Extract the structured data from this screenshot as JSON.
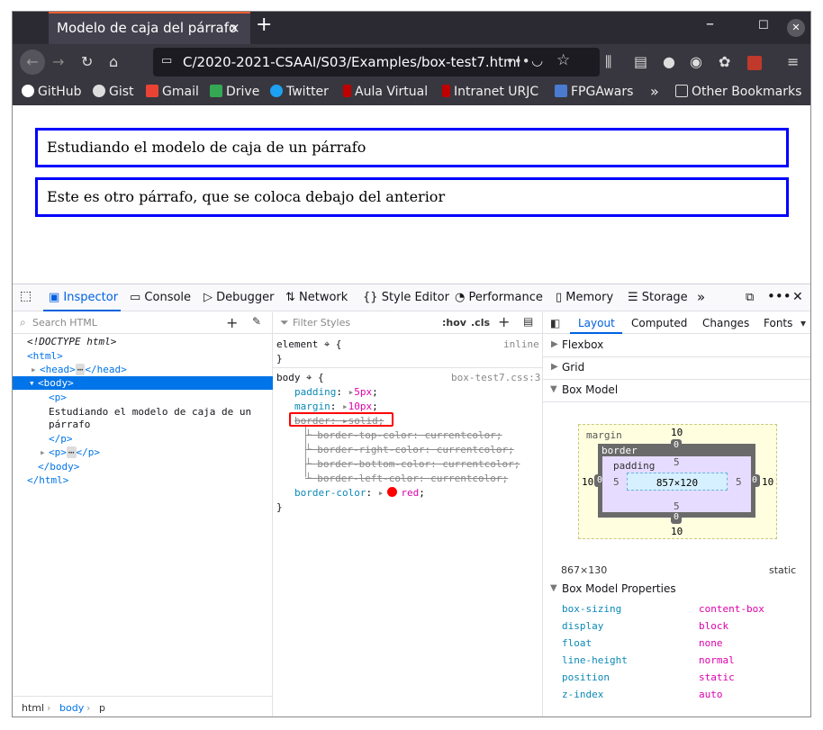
{
  "browser": {
    "tab_title": "Modelo de caja del párrafo",
    "tab_close": "×",
    "new_tab": "+",
    "url": "C/2020-2021-CSAAI/S03/Examples/box-test7.html",
    "url_more": "•••",
    "bookmarks": [
      {
        "label": "GitHub",
        "icon": "github-icon",
        "color": "#ffffff"
      },
      {
        "label": "Gist",
        "icon": "globe-icon",
        "color": "#dddddd"
      },
      {
        "label": "Gmail",
        "icon": "gmail-icon",
        "color": "#ea4335"
      },
      {
        "label": "Drive",
        "icon": "drive-icon",
        "color": "#34a853"
      },
      {
        "label": "Twitter",
        "icon": "twitter-icon",
        "color": "#1da1f2"
      },
      {
        "label": "Aula Virtual",
        "icon": "urjc-icon",
        "color": "#c00000"
      },
      {
        "label": "Intranet URJC",
        "icon": "urjc-icon",
        "color": "#c00000"
      },
      {
        "label": "FPGAwars",
        "icon": "fpgawars-icon",
        "color": "#4a7bd0"
      }
    ],
    "overflow": "»",
    "other_bookmarks": "Other Bookmarks"
  },
  "page": {
    "paragraphs": [
      "Estudiando el modelo de caja de un párrafo",
      "Este es otro párrafo, que se coloca debajo del anterior"
    ],
    "border_color": "#0000ff"
  },
  "devtools": {
    "tabs": [
      "Inspector",
      "Console",
      "Debugger",
      "Network",
      "Style Editor",
      "Performance",
      "Memory",
      "Storage"
    ],
    "search_placeholder": "Search HTML",
    "filter_placeholder": "Filter Styles",
    "hov": ":hov",
    "cls": ".cls",
    "html_tree": {
      "doctype": "<!DOCTYPE html>",
      "html_open": "<html>",
      "head": "<head>",
      "head_close": "</head>",
      "body_open": "<body>",
      "p_open": "<p>",
      "p_text_1": "Estudiando el modelo de caja de un",
      "p_text_2": "párrafo",
      "p_close": "</p>",
      "p2_open": "<p>",
      "p2_close": "</p>",
      "body_close": "</body>",
      "html_close": "</html>"
    },
    "breadcrumbs": [
      "html",
      "body",
      "p"
    ],
    "rules": {
      "element_selector": "element",
      "element_src": "inline",
      "body_selector": "body",
      "body_src": "box-test7.css:3",
      "decls": [
        {
          "prop": "padding",
          "value": "5px"
        },
        {
          "prop": "margin",
          "value": "10px"
        },
        {
          "prop": "border",
          "value": "solid"
        }
      ],
      "overridden": [
        "border-top-color: currentcolor;",
        "border-right-color: currentcolor;",
        "border-bottom-color: currentcolor;",
        "border-left-color: currentcolor;"
      ],
      "border_color_prop": "border-color",
      "border_color_value": "red",
      "highlight_color": "#ff0000"
    },
    "layout_tabs": [
      "Layout",
      "Computed",
      "Changes",
      "Fonts"
    ],
    "sections": [
      "Flexbox",
      "Grid",
      "Box Model"
    ],
    "box_model": {
      "margin_label": "margin",
      "border_label": "border",
      "padding_label": "padding",
      "margin": {
        "top": "10",
        "right": "10",
        "bottom": "10",
        "left": "10"
      },
      "border": {
        "top": "0",
        "right": "0",
        "bottom": "0",
        "left": "0"
      },
      "padding": {
        "top": "5",
        "right": "5",
        "bottom": "5",
        "left": "5"
      },
      "content": "857×120",
      "size": "867×130",
      "position": "static"
    },
    "box_props_title": "Box Model Properties",
    "box_props": [
      {
        "name": "box-sizing",
        "value": "content-box"
      },
      {
        "name": "display",
        "value": "block"
      },
      {
        "name": "float",
        "value": "none"
      },
      {
        "name": "line-height",
        "value": "normal"
      },
      {
        "name": "position",
        "value": "static"
      },
      {
        "name": "z-index",
        "value": "auto"
      }
    ]
  }
}
